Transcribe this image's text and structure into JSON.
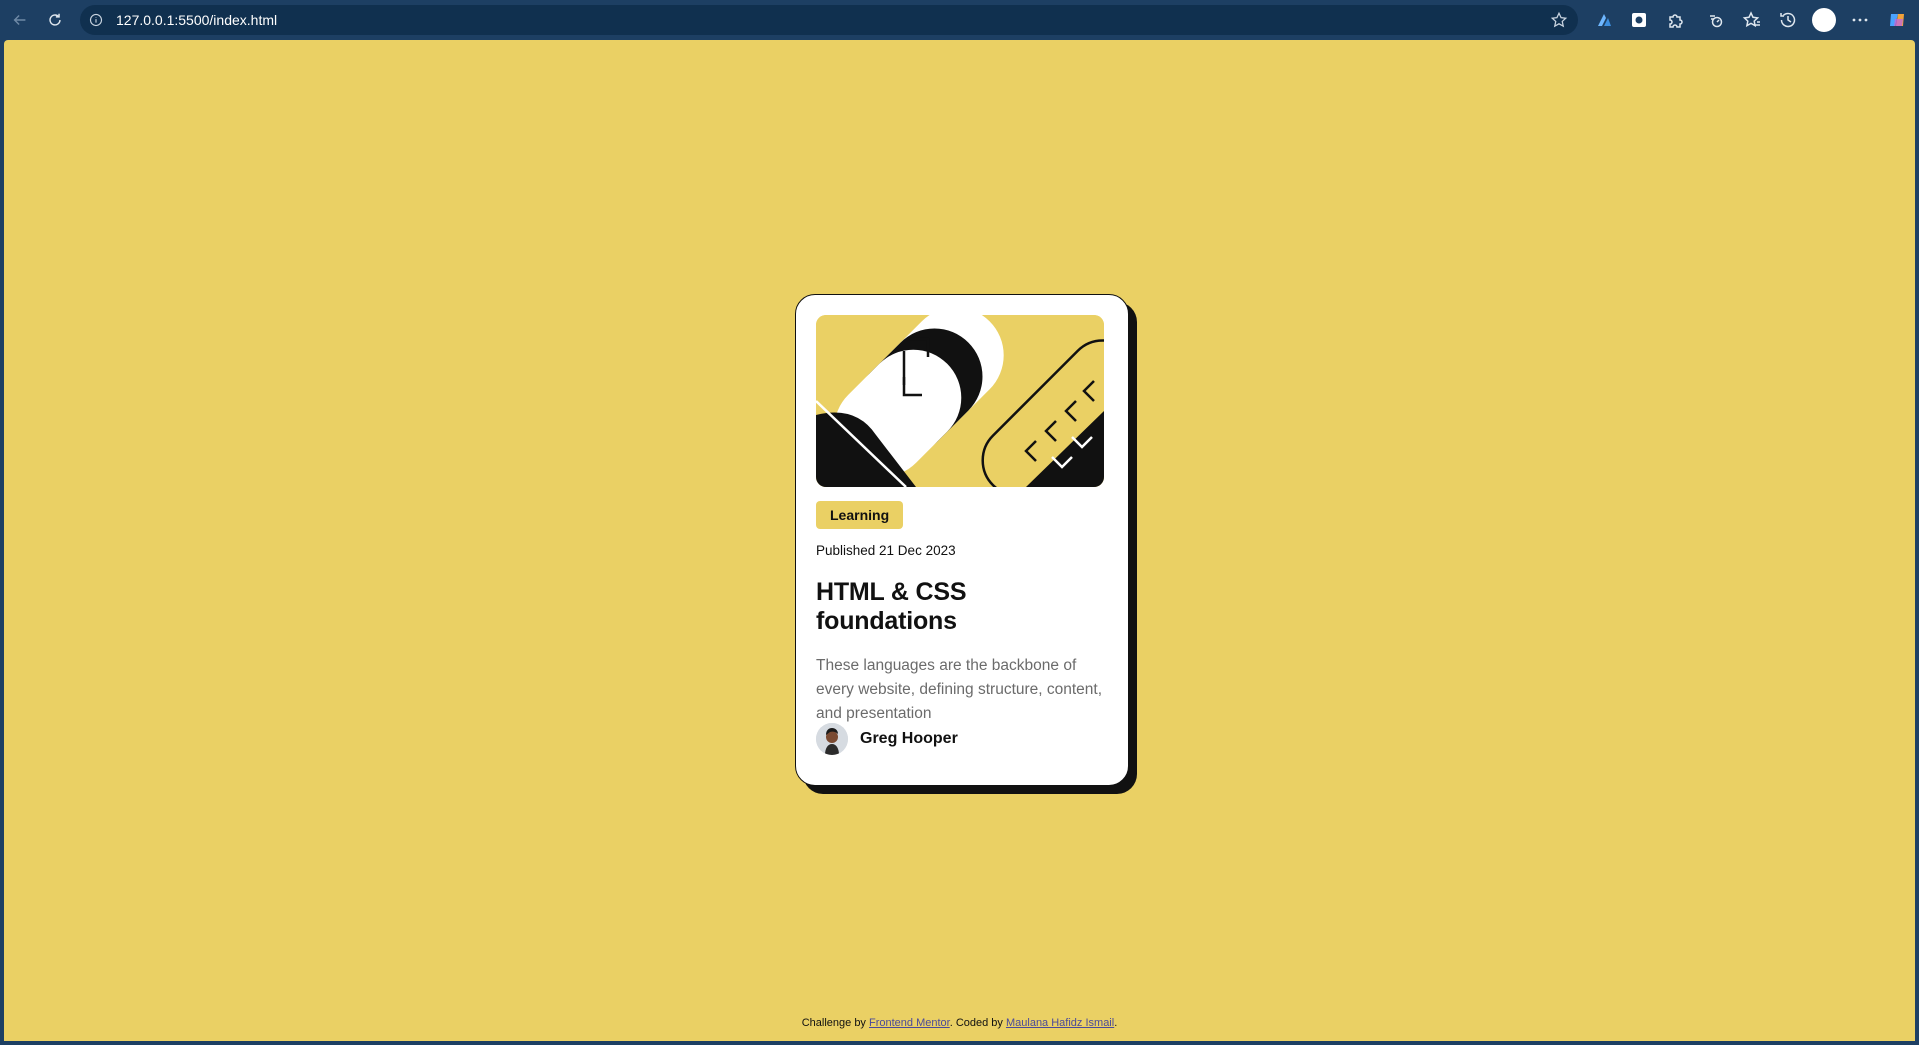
{
  "browser": {
    "url": "127.0.0.1:5500/index.html",
    "icons": [
      "back-icon",
      "refresh-icon",
      "site-info-icon",
      "favorite-star-icon",
      "extension-icon",
      "extension-icon",
      "puzzle-icon",
      "performance-icon",
      "favorites-icon",
      "history-icon",
      "profile-icon",
      "more-icon",
      "copilot-icon"
    ]
  },
  "colors": {
    "page_background": "#ead064",
    "card_background": "#ffffff",
    "ink": "#111111",
    "tag_background": "#ead064",
    "chrome": "#1d3f63"
  },
  "card": {
    "tag": "Learning",
    "published": "Published 21 Dec 2023",
    "title": "HTML & CSS foundations",
    "description": "These languages are the backbone of every website, defining structure, content, and presentation",
    "author": "Greg Hooper"
  },
  "footer": {
    "prefix": "Challenge by ",
    "link1": "Frontend Mentor",
    "middle": ". Coded by ",
    "link2": "Maulana Hafidz Ismail",
    "suffix": "."
  }
}
